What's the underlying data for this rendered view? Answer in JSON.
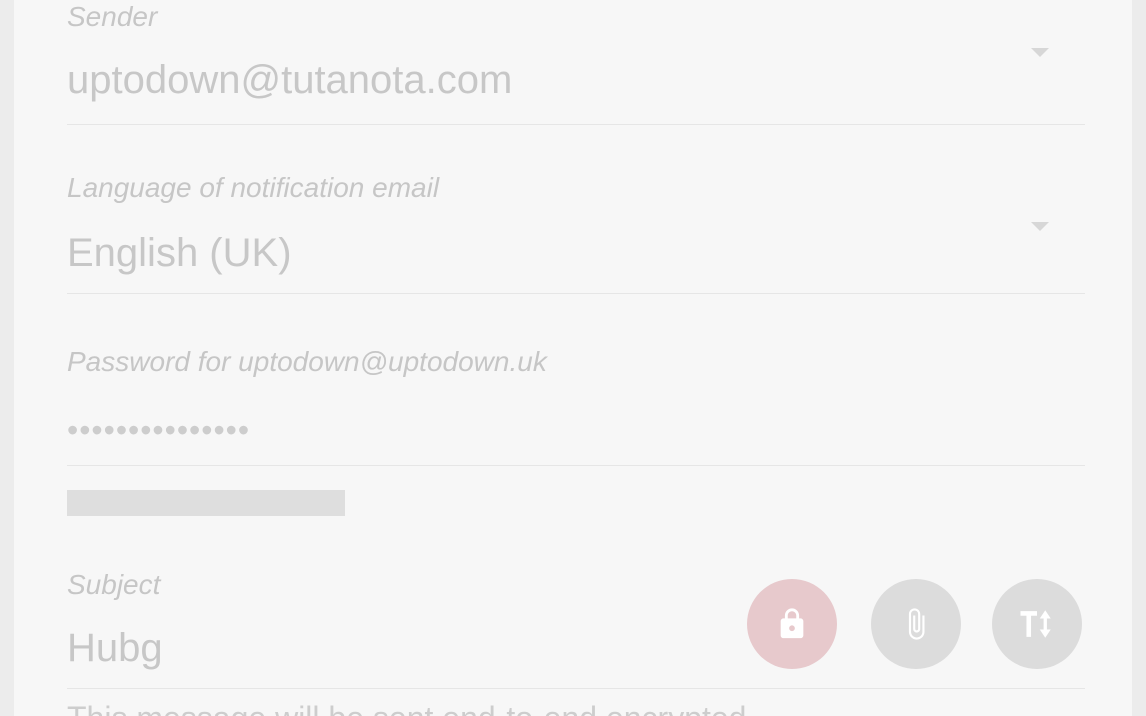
{
  "form": {
    "sender": {
      "label": "Sender",
      "value": "uptodown@tutanota.com"
    },
    "language": {
      "label": "Language of notification email",
      "value": "English (UK)"
    },
    "password": {
      "label": "Password for uptodown@uptodown.uk",
      "value": "•••••••••••••••"
    },
    "subject": {
      "label": "Subject",
      "value": "Hubg"
    },
    "footer_text": "This message will be sent end-to-end encrypted."
  },
  "icons": {
    "lock": "lock-icon",
    "attach": "paperclip-icon",
    "text_format": "text-size-icon",
    "dropdown": "chevron-down-icon"
  },
  "colors": {
    "lock_button": "#e7c9cc",
    "secondary_button": "#dcdcdc",
    "background": "#f7f7f7"
  }
}
